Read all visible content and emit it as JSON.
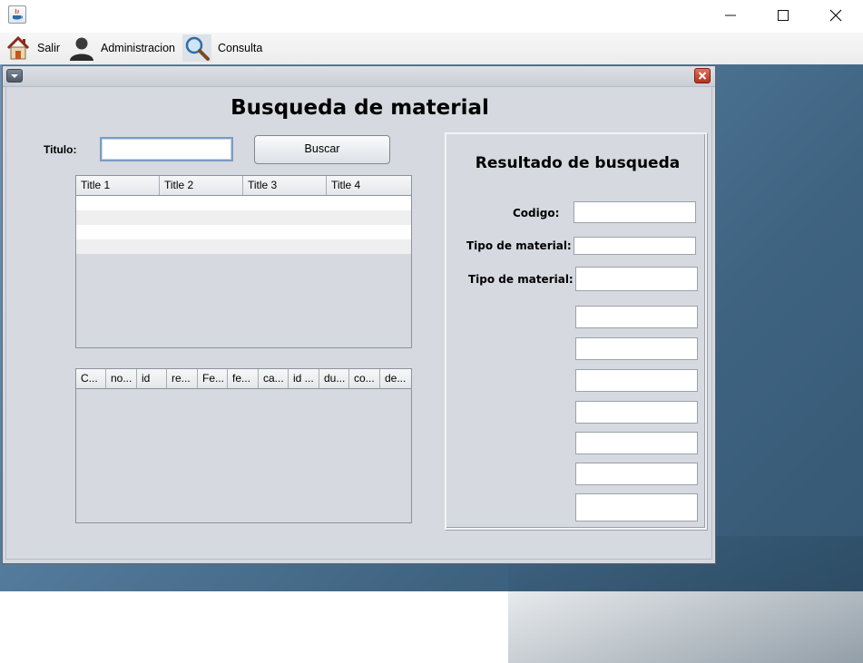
{
  "menu": {
    "items": [
      {
        "label": "Salir",
        "icon": "home-icon"
      },
      {
        "label": "Administracion",
        "icon": "user-icon"
      },
      {
        "label": "Consulta",
        "icon": "magnifier-icon"
      }
    ]
  },
  "form": {
    "title": "Busqueda de material",
    "titulo_label": "Titulo:",
    "titulo_value": "",
    "search_button": "Buscar"
  },
  "table1": {
    "columns": [
      "Title 1",
      "Title 2",
      "Title 3",
      "Title 4"
    ]
  },
  "table2": {
    "columns": [
      "C...",
      "no...",
      "id",
      "re...",
      "Fe...",
      "fe...",
      "ca...",
      "id ...",
      "du...",
      "co...",
      "de..."
    ]
  },
  "results": {
    "title": "Resultado de busqueda",
    "codigo_label": "Codigo:",
    "tipo_label_1": "Tipo de material:",
    "tipo_label_2": "Tipo de material:"
  },
  "colors": {
    "frame_bg": "#d6d9df",
    "close_button": "#c23a28",
    "desktop": "#4a7090"
  }
}
